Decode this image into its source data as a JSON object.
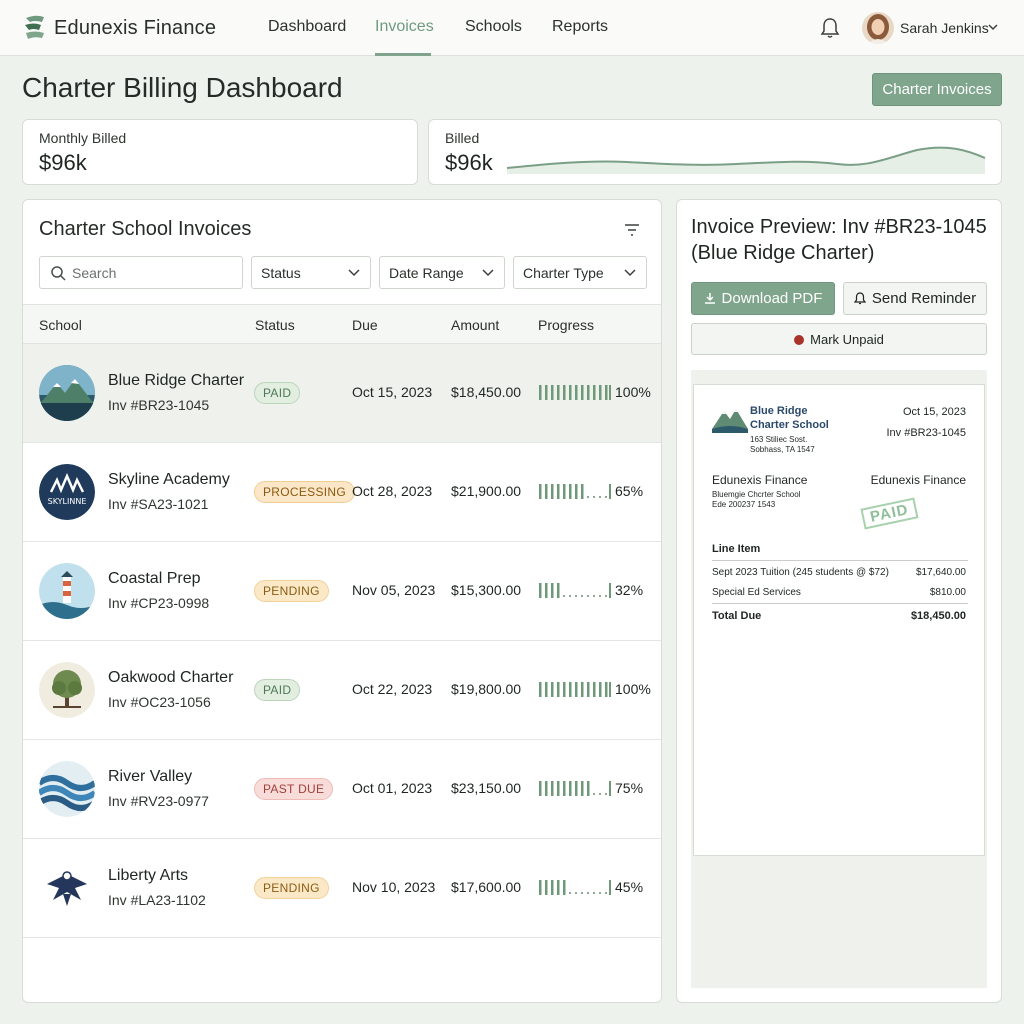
{
  "app": {
    "brand": "Edunexis Finance"
  },
  "nav": {
    "items": [
      {
        "label": "Dashboard",
        "active": false
      },
      {
        "label": "Invoices",
        "active": true
      },
      {
        "label": "Schools",
        "active": false
      },
      {
        "label": "Reports",
        "active": false
      }
    ],
    "user_name": "Sarah Jenkins",
    "icons": {
      "notifications": "bell-icon",
      "user_menu": "chevron-down-icon"
    }
  },
  "page": {
    "title": "Charter Billing Dashboard",
    "action_button": "Charter Invoices"
  },
  "kpis": {
    "monthly": {
      "label": "Monthly Billed",
      "value": "$96k"
    },
    "billed": {
      "label": "Billed",
      "value": "$96k"
    }
  },
  "invoices": {
    "title": "Charter School Invoices",
    "search_placeholder": "Search",
    "filters": [
      "Status",
      "Date Range",
      "Charter Type"
    ],
    "columns": [
      "School",
      "Status",
      "Due",
      "Amount",
      "Progress"
    ],
    "rows": [
      {
        "school": "Blue Ridge Charter",
        "invoice": "Inv #BR23-1045",
        "status": "PAID",
        "status_kind": "paid",
        "due": "Oct 15, 2023",
        "amount": "$18,450.00",
        "progress": 100,
        "progress_label": "100%",
        "selected": true
      },
      {
        "school": "Skyline Academy",
        "invoice": "Inv #SA23-1021",
        "status": "PROCESSING",
        "status_kind": "processing",
        "due": "Oct 28, 2023",
        "amount": "$21,900.00",
        "progress": 65,
        "progress_label": "65%",
        "selected": false
      },
      {
        "school": "Coastal Prep",
        "invoice": "Inv #CP23-0998",
        "status": "PENDING",
        "status_kind": "pending",
        "due": "Nov 05, 2023",
        "amount": "$15,300.00",
        "progress": 32,
        "progress_label": "32%",
        "selected": false
      },
      {
        "school": "Oakwood Charter",
        "invoice": "Inv #OC23-1056",
        "status": "PAID",
        "status_kind": "paid",
        "due": "Oct 22, 2023",
        "amount": "$19,800.00",
        "progress": 100,
        "progress_label": "100%",
        "selected": false
      },
      {
        "school": "River Valley",
        "invoice": "Inv #RV23-0977",
        "status": "PAST DUE",
        "status_kind": "pastdue",
        "due": "Oct 01, 2023",
        "amount": "$23,150.00",
        "progress": 75,
        "progress_label": "75%",
        "selected": false
      },
      {
        "school": "Liberty Arts",
        "invoice": "Inv #LA23-1102",
        "status": "PENDING",
        "status_kind": "pending",
        "due": "Nov 10, 2023",
        "amount": "$17,600.00",
        "progress": 45,
        "progress_label": "45%",
        "selected": false
      }
    ],
    "logo_text": {
      "skyline": "SKYLINNE"
    }
  },
  "preview": {
    "title": "Invoice Preview: Inv #BR23-1045 (Blue Ridge Charter)",
    "download_label": "Download PDF",
    "reminder_label": "Send Reminder",
    "unpaid_label": "Mark Unpaid",
    "doc": {
      "school_line1": "Blue Ridge",
      "school_line2": "Charter School",
      "address1": "163 Stiliec Sost.",
      "address2": "Sobhass, TA 1547",
      "date": "Oct 15, 2023",
      "invoice_no": "Inv #BR23-1045",
      "from_left": "Edunexis Finance",
      "from_right": "Edunexis Finance",
      "billto1": "Bluemgie Chcrter School",
      "billto2": "Ede 200237 1543",
      "stamp": "PAID",
      "line_header": "Line Item",
      "lines": [
        {
          "desc": "Sept 2023 Tuition (245 students @ $72)",
          "amount": "$17,640.00"
        },
        {
          "desc": "Special Ed Services",
          "amount": "$810.00"
        }
      ],
      "total_label": "Total Due",
      "total_amount": "$18,450.00"
    }
  },
  "colors": {
    "accent": "#7fa58c",
    "nav_active": "#6f9a7f",
    "paid": "#4f7a57",
    "pending": "#8a5d14",
    "pastdue": "#a13f3a",
    "progress": "#6e9878"
  }
}
